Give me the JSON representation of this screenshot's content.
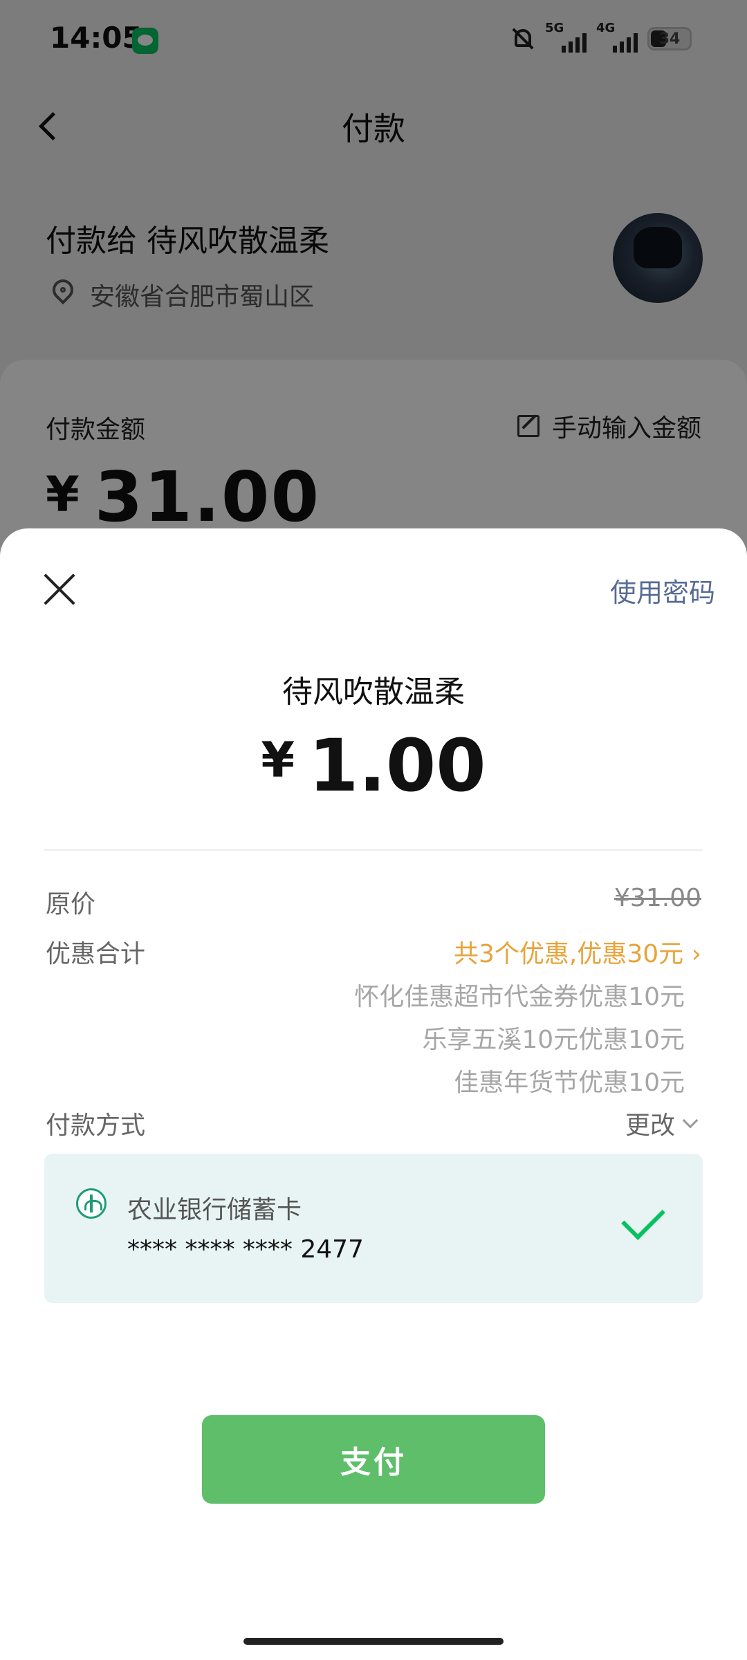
{
  "status_bar": {
    "time": "14:05",
    "network_1": "5G",
    "network_2": "4G",
    "battery": "34"
  },
  "nav": {
    "title": "付款"
  },
  "payee": {
    "title": "付款给 待风吹散温柔",
    "location": "安徽省合肥市蜀山区"
  },
  "amount_card": {
    "label": "付款金额",
    "manual_input_label": "手动输入金额",
    "currency": "¥",
    "amount": "31.00"
  },
  "sheet": {
    "use_password": "使用密码",
    "payee_name": "待风吹散温柔",
    "currency": "¥",
    "amount": "1.00",
    "original_price_label": "原价",
    "original_price": "¥31.00",
    "discount_label": "优惠合计",
    "discount_total": "共3个优惠,优惠30元 ›",
    "discounts": [
      "怀化佳惠超市代金券优惠10元",
      "乐享五溪10元优惠10元",
      "佳惠年货节优惠10元"
    ],
    "payment_method_label": "付款方式",
    "change_label": "更改",
    "card": {
      "bank": "农业银行储蓄卡",
      "number": "**** **** **** 2477"
    },
    "pay_button": "支付"
  },
  "colors": {
    "accent_green": "#07c160",
    "button_green": "#5fbe6a",
    "link_blue": "#576b95",
    "discount_orange": "#e8a33a"
  }
}
